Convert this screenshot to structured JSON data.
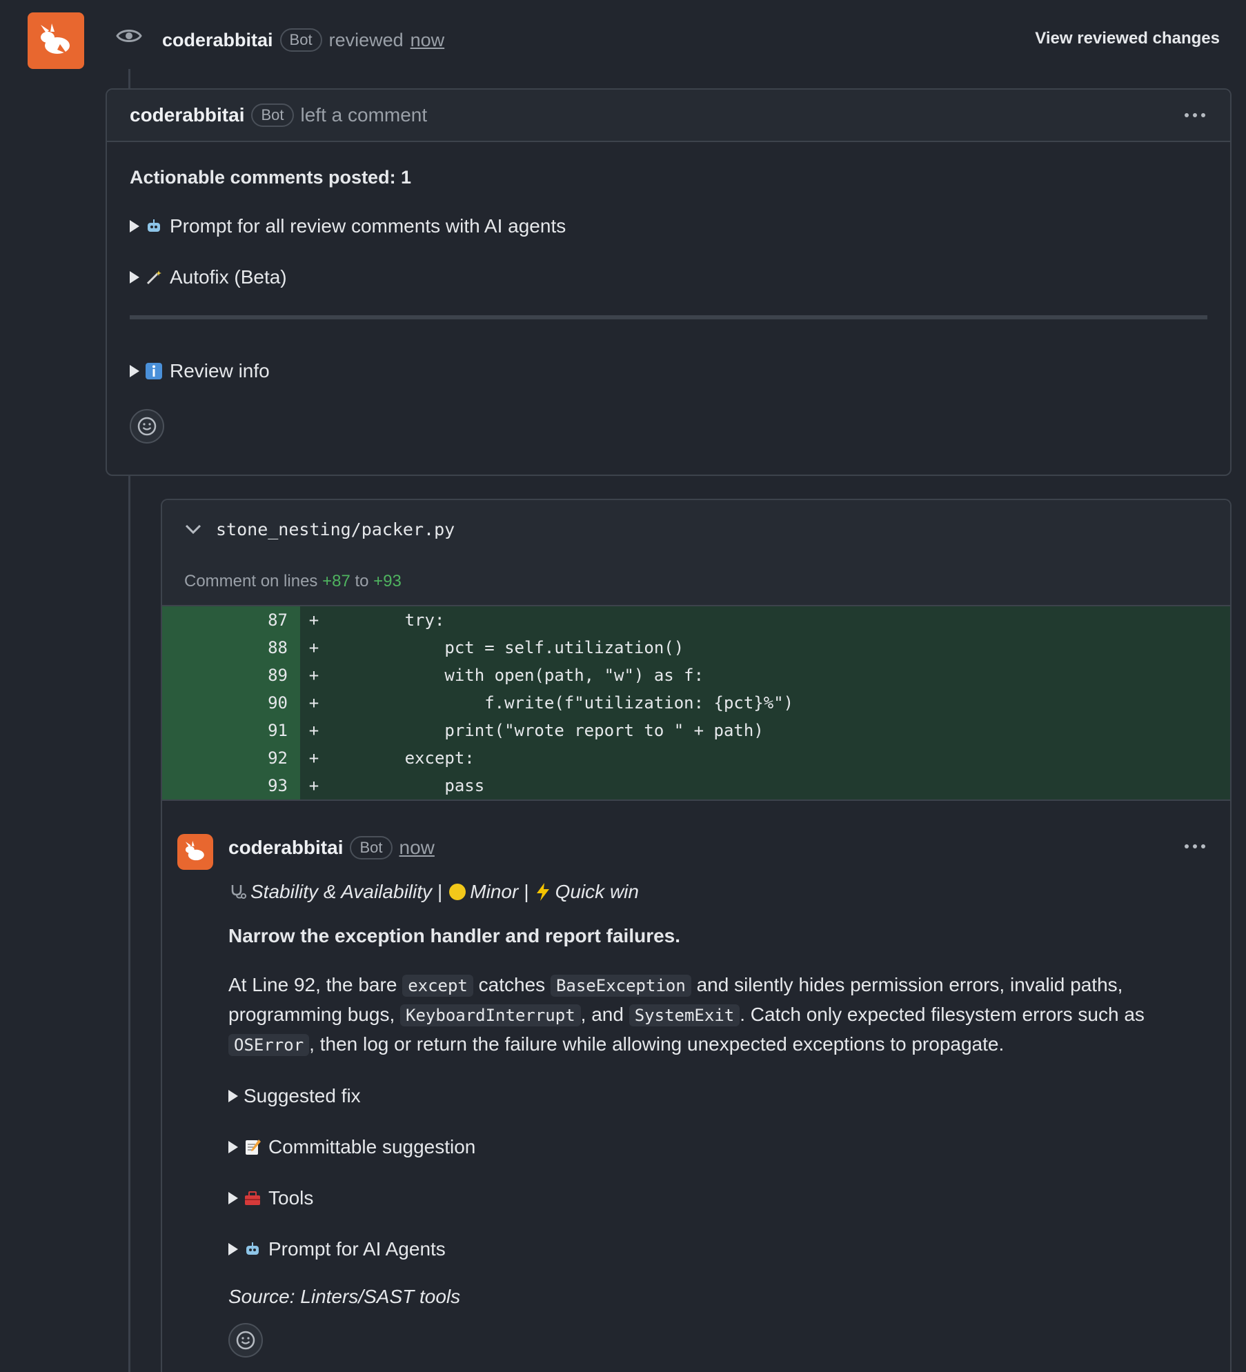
{
  "review": {
    "author": "coderabbitai",
    "badge": "Bot",
    "action": "reviewed",
    "time": "now",
    "view_changes": "View reviewed changes"
  },
  "summary_comment": {
    "author": "coderabbitai",
    "badge": "Bot",
    "action": "left a comment",
    "actionable": "Actionable comments posted: 1",
    "items": [
      {
        "icon": "robot-icon",
        "label": "Prompt for all review comments with AI agents"
      },
      {
        "icon": "magic-wand-icon",
        "label": "Autofix (Beta)"
      }
    ],
    "review_info": {
      "icon": "info-icon",
      "label": "Review info"
    }
  },
  "file": {
    "path": "stone_nesting/packer.py",
    "comment_prefix": "Comment on lines",
    "line_start": "+87",
    "comment_to": "to",
    "line_end": "+93",
    "diff": [
      {
        "num": "87",
        "sign": "+",
        "code": "        try:"
      },
      {
        "num": "88",
        "sign": "+",
        "code": "            pct = self.utilization()"
      },
      {
        "num": "89",
        "sign": "+",
        "code": "            with open(path, \"w\") as f:"
      },
      {
        "num": "90",
        "sign": "+",
        "code": "                f.write(f\"utilization: {pct}%\")"
      },
      {
        "num": "91",
        "sign": "+",
        "code": "            print(\"wrote report to \" + path)"
      },
      {
        "num": "92",
        "sign": "+",
        "code": "        except:"
      },
      {
        "num": "93",
        "sign": "+",
        "code": "            pass"
      }
    ]
  },
  "inline_comment": {
    "author": "coderabbitai",
    "badge": "Bot",
    "time": "now",
    "tag_category": "Stability & Availability",
    "tag_severity": "Minor",
    "tag_effort": "Quick win",
    "tag_sep": "|",
    "headline": "Narrow the exception handler and report failures.",
    "para": {
      "t1": "At Line 92, the bare ",
      "c1": "except",
      "t2": " catches ",
      "c2": "BaseException",
      "t3": " and silently hides permission errors, invalid paths, programming bugs, ",
      "c3": "KeyboardInterrupt",
      "t4": ", and ",
      "c4": "SystemExit",
      "t5": ". Catch only expected filesystem errors such as ",
      "c5": "OSError",
      "t6": ", then log or return the failure while allowing unexpected exceptions to propagate."
    },
    "details": [
      {
        "icon": "",
        "label": "Suggested fix"
      },
      {
        "icon": "memo-icon",
        "label": "Committable suggestion"
      },
      {
        "icon": "toolbox-icon",
        "label": "Tools"
      },
      {
        "icon": "robot-icon",
        "label": "Prompt for AI Agents"
      }
    ],
    "source": "Source: Linters/SAST tools"
  },
  "colors": {
    "accent": "#e8672f",
    "added_line": "#4fb35f",
    "diff_bg": "#213a2f"
  }
}
